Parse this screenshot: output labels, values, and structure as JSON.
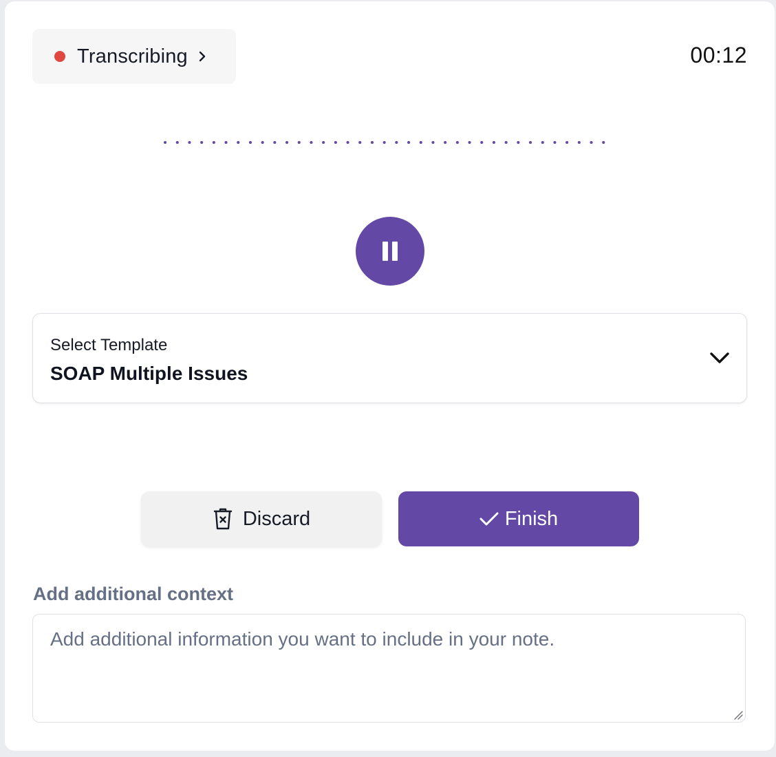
{
  "status": {
    "label": "Transcribing",
    "recording_color": "#e0483f",
    "icon": "chevron-right-icon"
  },
  "timer": "00:12",
  "waveform": {
    "color": "#6349a5"
  },
  "controls": {
    "pause_icon": "pause-icon",
    "accent_color": "#6349a5"
  },
  "template": {
    "label": "Select Template",
    "value": "SOAP Multiple Issues",
    "icon": "chevron-down-icon"
  },
  "actions": {
    "discard_label": "Discard",
    "discard_icon": "trash-x-icon",
    "finish_label": "Finish",
    "finish_icon": "check-icon"
  },
  "context": {
    "label": "Add additional context",
    "placeholder": "Add additional information you want to include in your note.",
    "value": ""
  }
}
